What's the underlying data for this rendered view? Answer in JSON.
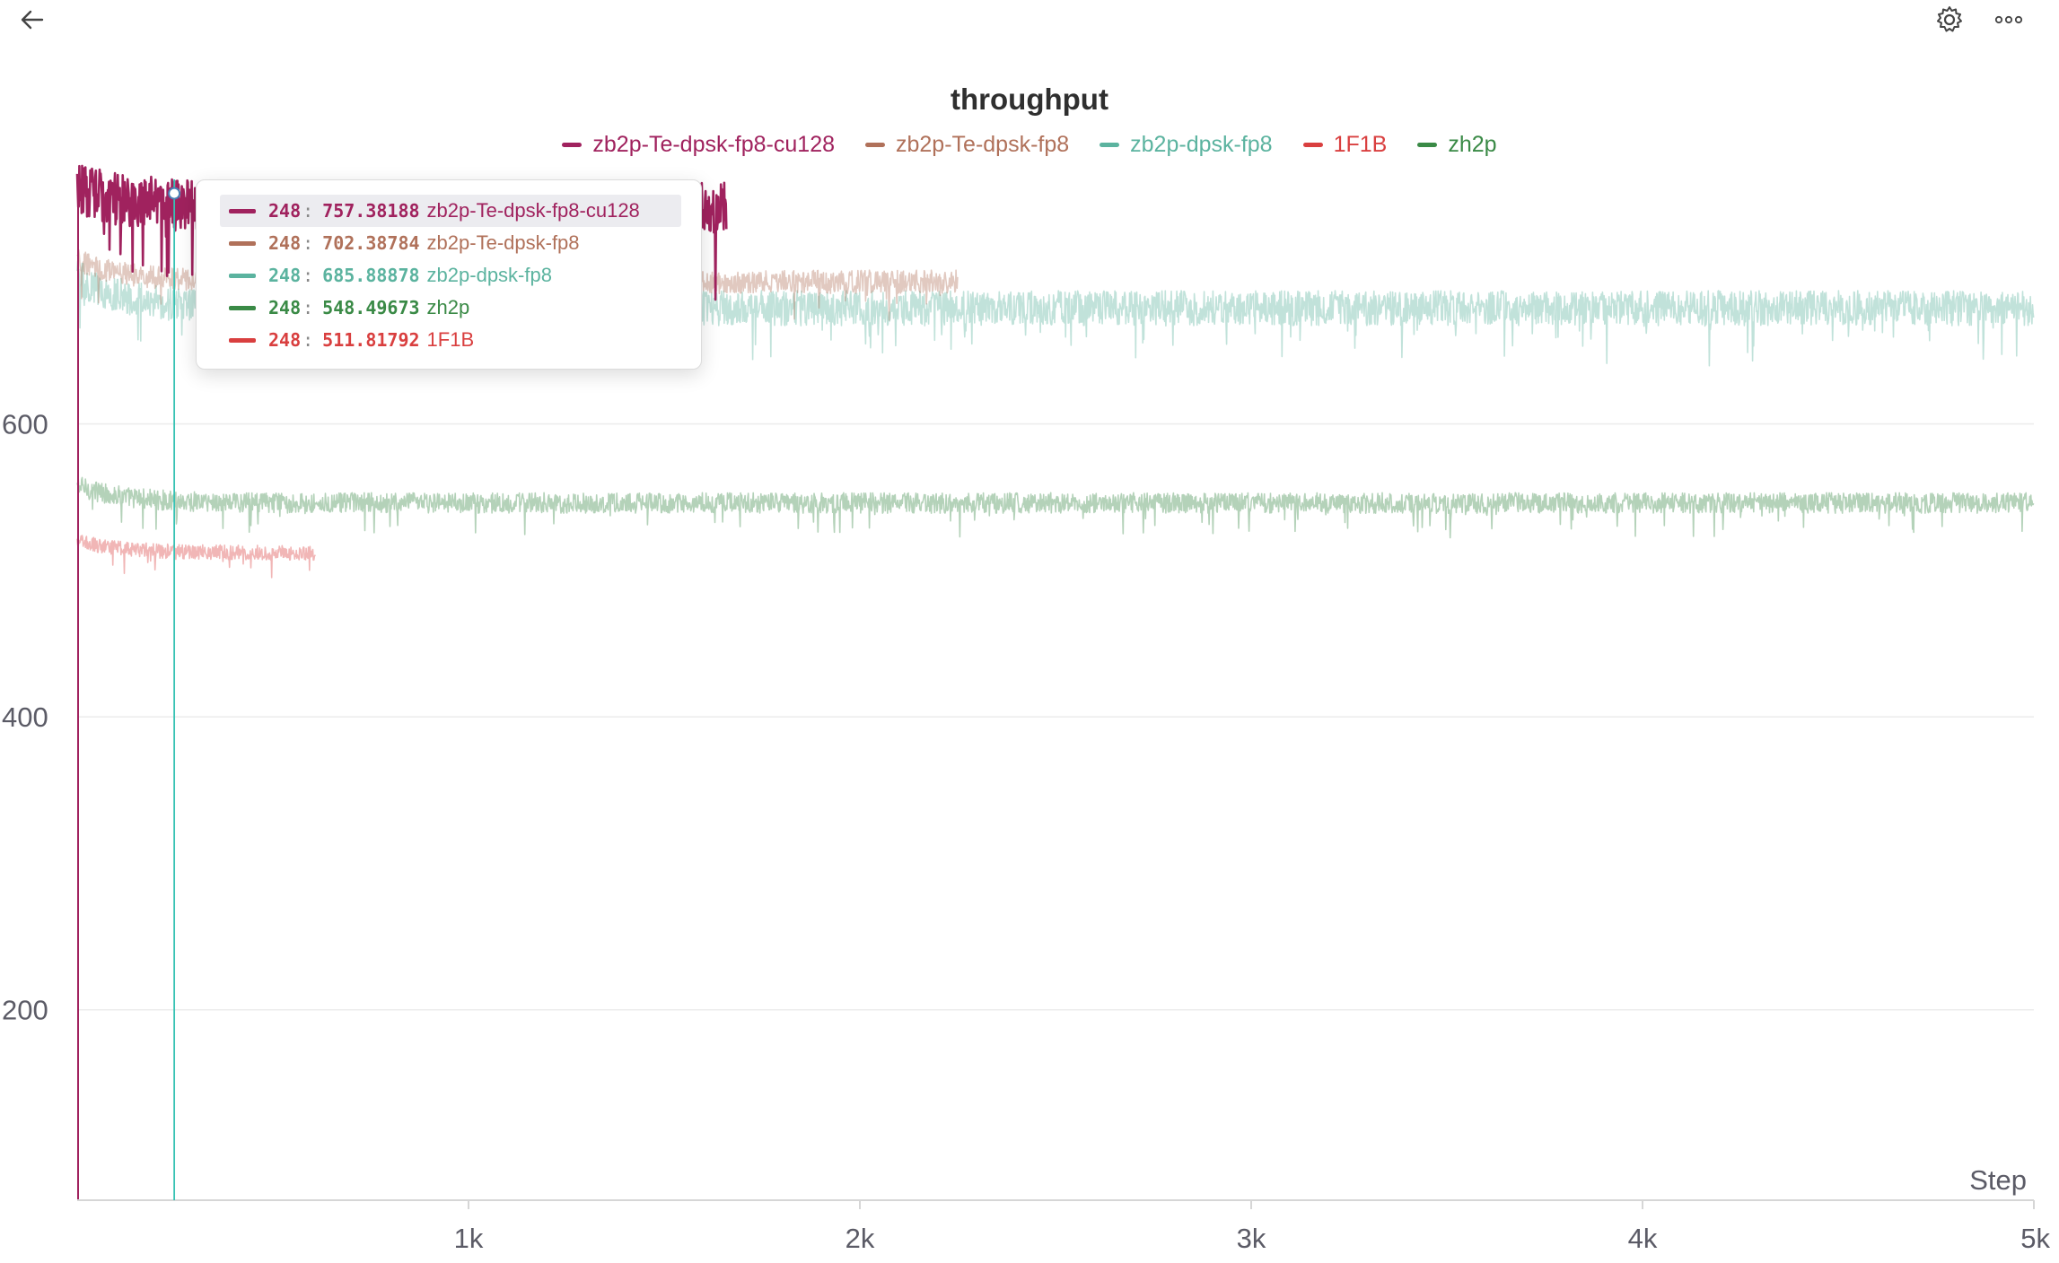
{
  "toolbar": {
    "back_icon": "arrow-left-icon",
    "settings_icon": "gear-icon",
    "more_icon": "more-horizontal-icon"
  },
  "chart_data": {
    "type": "line",
    "title": "throughput",
    "xlabel": "Step",
    "ylabel": "",
    "xlim": [
      0,
      5000
    ],
    "ylim": [
      70,
      770
    ],
    "x_ticks": [
      "1k",
      "2k",
      "3k",
      "4k",
      "5k"
    ],
    "x_tick_values": [
      1000,
      2000,
      3000,
      4000,
      5000
    ],
    "y_ticks": [
      "200",
      "400",
      "600"
    ],
    "y_tick_values": [
      200,
      400,
      600
    ],
    "grid": true,
    "legend_position": "top-center",
    "series": [
      {
        "name": "zb2p-Te-dpsk-fp8-cu128",
        "color": "#a0225e",
        "x_range": [
          0,
          1660
        ],
        "mean": 748,
        "noise": 18,
        "start": 762,
        "points": [
          {
            "x": 0,
            "y": 762
          },
          {
            "x": 248,
            "y": 757.38188
          },
          {
            "x": 1000,
            "y": 747
          },
          {
            "x": 1660,
            "y": 742
          }
        ]
      },
      {
        "name": "zb2p-Te-dpsk-fp8",
        "color": "#b0715a",
        "x_range": [
          0,
          2250
        ],
        "mean": 697,
        "noise": 8,
        "start": 712,
        "points": [
          {
            "x": 0,
            "y": 712
          },
          {
            "x": 248,
            "y": 702.38784
          },
          {
            "x": 1000,
            "y": 698
          },
          {
            "x": 2250,
            "y": 697
          }
        ]
      },
      {
        "name": "zb2p-dpsk-fp8",
        "color": "#5bb39f",
        "x_range": [
          0,
          5000
        ],
        "mean": 679,
        "noise": 12,
        "start": 700,
        "points": [
          {
            "x": 0,
            "y": 700
          },
          {
            "x": 248,
            "y": 685.88878
          },
          {
            "x": 2500,
            "y": 679
          },
          {
            "x": 5000,
            "y": 680
          }
        ]
      },
      {
        "name": "1F1B",
        "color": "#d93f3f",
        "x_range": [
          0,
          610
        ],
        "mean": 512,
        "noise": 5,
        "start": 520,
        "points": [
          {
            "x": 0,
            "y": 520
          },
          {
            "x": 248,
            "y": 511.81792
          },
          {
            "x": 610,
            "y": 510
          }
        ]
      },
      {
        "name": "zh2p",
        "color": "#3a8a46",
        "x_range": [
          0,
          5000
        ],
        "mean": 546,
        "noise": 7,
        "start": 558,
        "points": [
          {
            "x": 0,
            "y": 558
          },
          {
            "x": 248,
            "y": 548.49673
          },
          {
            "x": 2500,
            "y": 546
          },
          {
            "x": 5000,
            "y": 547
          }
        ]
      }
    ],
    "legend_order": [
      "zb2p-Te-dpsk-fp8-cu128",
      "zb2p-Te-dpsk-fp8",
      "zb2p-dpsk-fp8",
      "1F1B",
      "zh2p"
    ],
    "hover": {
      "step": 248,
      "rows": [
        {
          "step": "248",
          "value": "757.38188",
          "name": "zb2p-Te-dpsk-fp8-cu128",
          "color": "#a0225e"
        },
        {
          "step": "248",
          "value": "702.38784",
          "name": "zb2p-Te-dpsk-fp8",
          "color": "#b0715a"
        },
        {
          "step": "248",
          "value": "685.88878",
          "name": "zb2p-dpsk-fp8",
          "color": "#5bb39f"
        },
        {
          "step": "248",
          "value": "548.49673",
          "name": "zh2p",
          "color": "#3a8a46"
        },
        {
          "step": "248",
          "value": "511.81792",
          "name": "1F1B",
          "color": "#d93f3f"
        }
      ]
    }
  }
}
